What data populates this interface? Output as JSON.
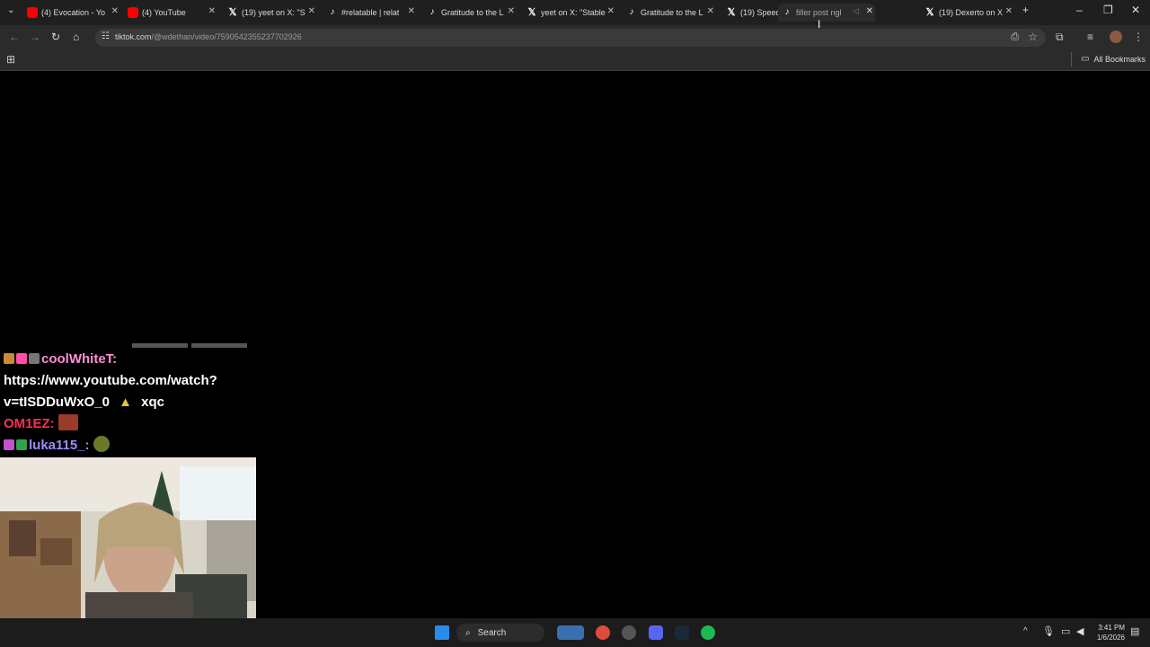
{
  "tabs": [
    {
      "title": "(4) Evocation - Yo",
      "icon": "youtube-icon"
    },
    {
      "title": "(4) YouTube",
      "icon": "youtube-icon"
    },
    {
      "title": "(19) yeet on X: \"S",
      "icon": "x-logo-icon"
    },
    {
      "title": "#relatable | relat",
      "icon": "tiktok-icon"
    },
    {
      "title": "Gratitude to the L",
      "icon": "tiktok-icon"
    },
    {
      "title": "yeet on X: \"Stable",
      "icon": "x-logo-icon"
    },
    {
      "title": "Gratitude to the L",
      "icon": "tiktok-icon"
    },
    {
      "title": "(19) Speedy",
      "icon": "x-logo-icon"
    },
    {
      "title": "filler post ngl",
      "icon": "tiktok-icon"
    },
    {
      "title": "(19) Dexerto on X",
      "icon": "x-logo-icon"
    }
  ],
  "address": {
    "domain": "tiktok.com",
    "path": "/@wdethan/video/7590542355237702926"
  },
  "bookmarks": {
    "all_label": "All Bookmarks"
  },
  "chat": {
    "user1": "coolWhiteT:",
    "msg1a": "https://www.youtube.com/watch?",
    "msg1b": "v=tISDDuWxO_0",
    "msg1c": "xqc",
    "user2": "OM1EZ:",
    "user3": "luka115_:"
  },
  "taskbar": {
    "search_label": "Search",
    "time": "3:41 PM",
    "date": "1/6/2026"
  },
  "colors": {
    "user1": "#ff8fd6",
    "user2": "#ff2d55",
    "user3": "#9c8cff"
  }
}
